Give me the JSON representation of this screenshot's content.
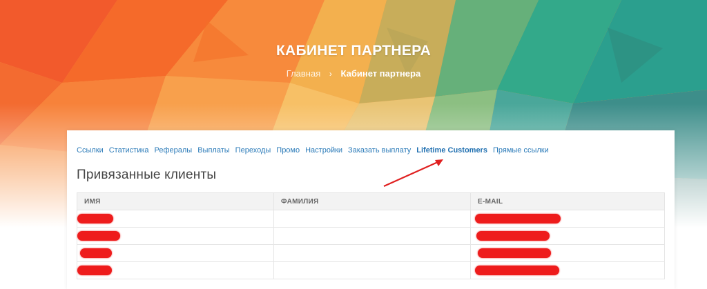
{
  "header": {
    "title": "КАБИНЕТ ПАРТНЕРА",
    "breadcrumb": {
      "home": "Главная",
      "separator": "›",
      "current": "Кабинет партнера"
    }
  },
  "tabs": [
    {
      "label": "Ссылки",
      "active": false
    },
    {
      "label": "Статистика",
      "active": false
    },
    {
      "label": "Рефералы",
      "active": false
    },
    {
      "label": "Выплаты",
      "active": false
    },
    {
      "label": "Переходы",
      "active": false
    },
    {
      "label": "Промо",
      "active": false
    },
    {
      "label": "Настройки",
      "active": false
    },
    {
      "label": "Заказать выплату",
      "active": false
    },
    {
      "label": "Lifetime Customers",
      "active": true
    },
    {
      "label": "Прямые ссылки",
      "active": false
    }
  ],
  "section": {
    "title": "Привязанные клиенты"
  },
  "table": {
    "columns": [
      "ИМЯ",
      "ФАМИЛИЯ",
      "E-MAIL"
    ],
    "rows_redacted": 4
  },
  "colors": {
    "accent_link": "#2a7ab8",
    "redaction": "#ee1c1c",
    "arrow": "#e02020"
  }
}
